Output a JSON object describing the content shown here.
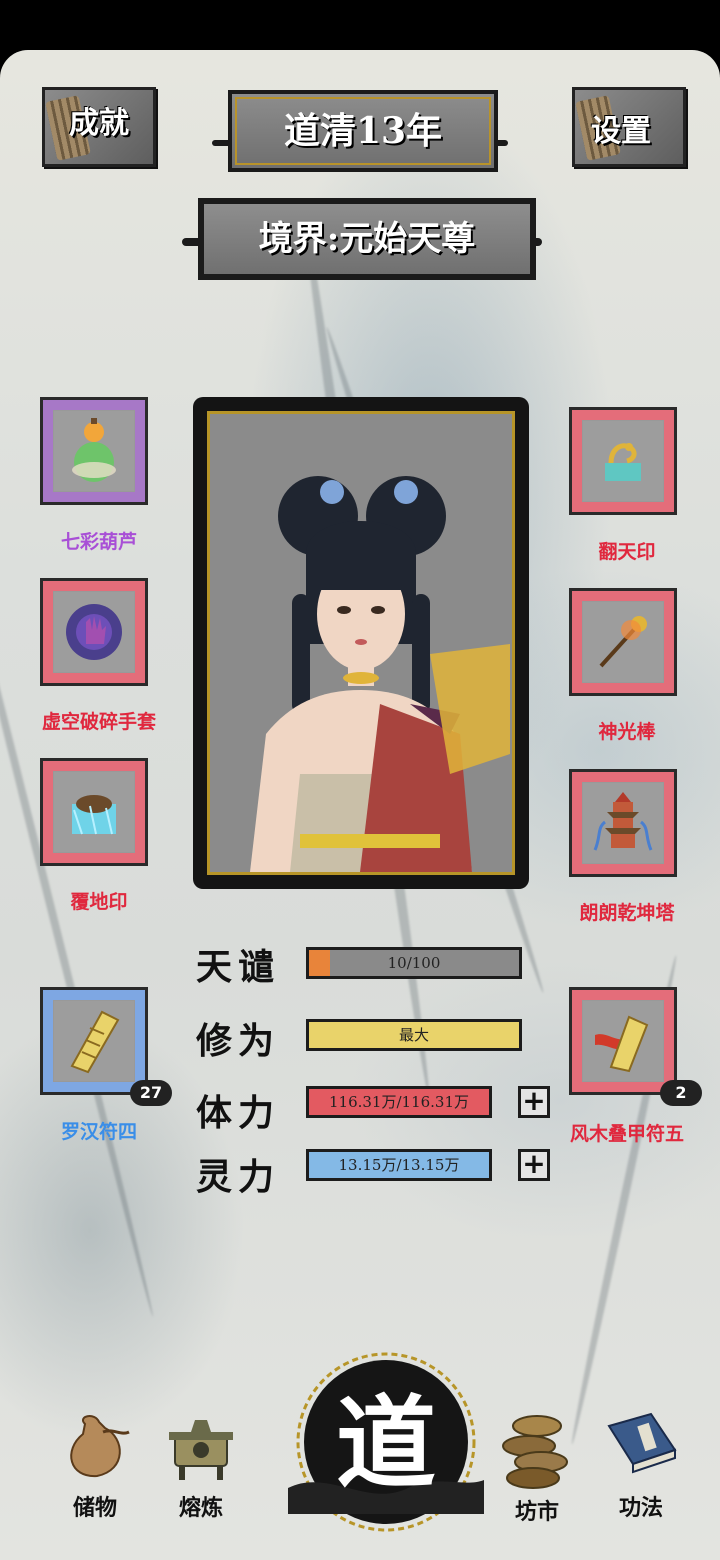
{
  "header": {
    "achievements_label": "成就",
    "year_label": "道清13年",
    "settings_label": "设置",
    "realm_label": "境界:元始天尊"
  },
  "left_slots": [
    {
      "name": "七彩葫芦",
      "color": "#a84fd6"
    },
    {
      "name": "虚空破碎手套",
      "color": "#e0283e"
    },
    {
      "name": "覆地印",
      "color": "#e0283e"
    },
    {
      "name": "罗汉符四",
      "color": "#3a8ee8",
      "count": "27"
    }
  ],
  "right_slots": [
    {
      "name": "翻天印",
      "color": "#e0283e"
    },
    {
      "name": "神光棒",
      "color": "#e0283e"
    },
    {
      "name": "朗朗乾坤塔",
      "color": "#e0283e"
    },
    {
      "name": "风木叠甲符五",
      "color": "#e0283e",
      "count": "2"
    }
  ],
  "stats": {
    "tribulation": {
      "label": "天谴",
      "value": "10/100",
      "fraction": 0.1
    },
    "cultivation": {
      "label": "修为",
      "value": "最大"
    },
    "stamina": {
      "label": "体力",
      "value": "116.31万/116.31万"
    },
    "spirit": {
      "label": "灵力",
      "value": "13.15万/13.15万"
    }
  },
  "nav": {
    "storage": "储物",
    "refine": "熔炼",
    "dao": "道",
    "market": "坊市",
    "skills": "功法"
  },
  "colors": {
    "tribulation_fill": "#e8843a",
    "cultivation_fill": "#e9d36a",
    "stamina_fill": "#e35a61",
    "spirit_fill": "#84b9e6"
  }
}
